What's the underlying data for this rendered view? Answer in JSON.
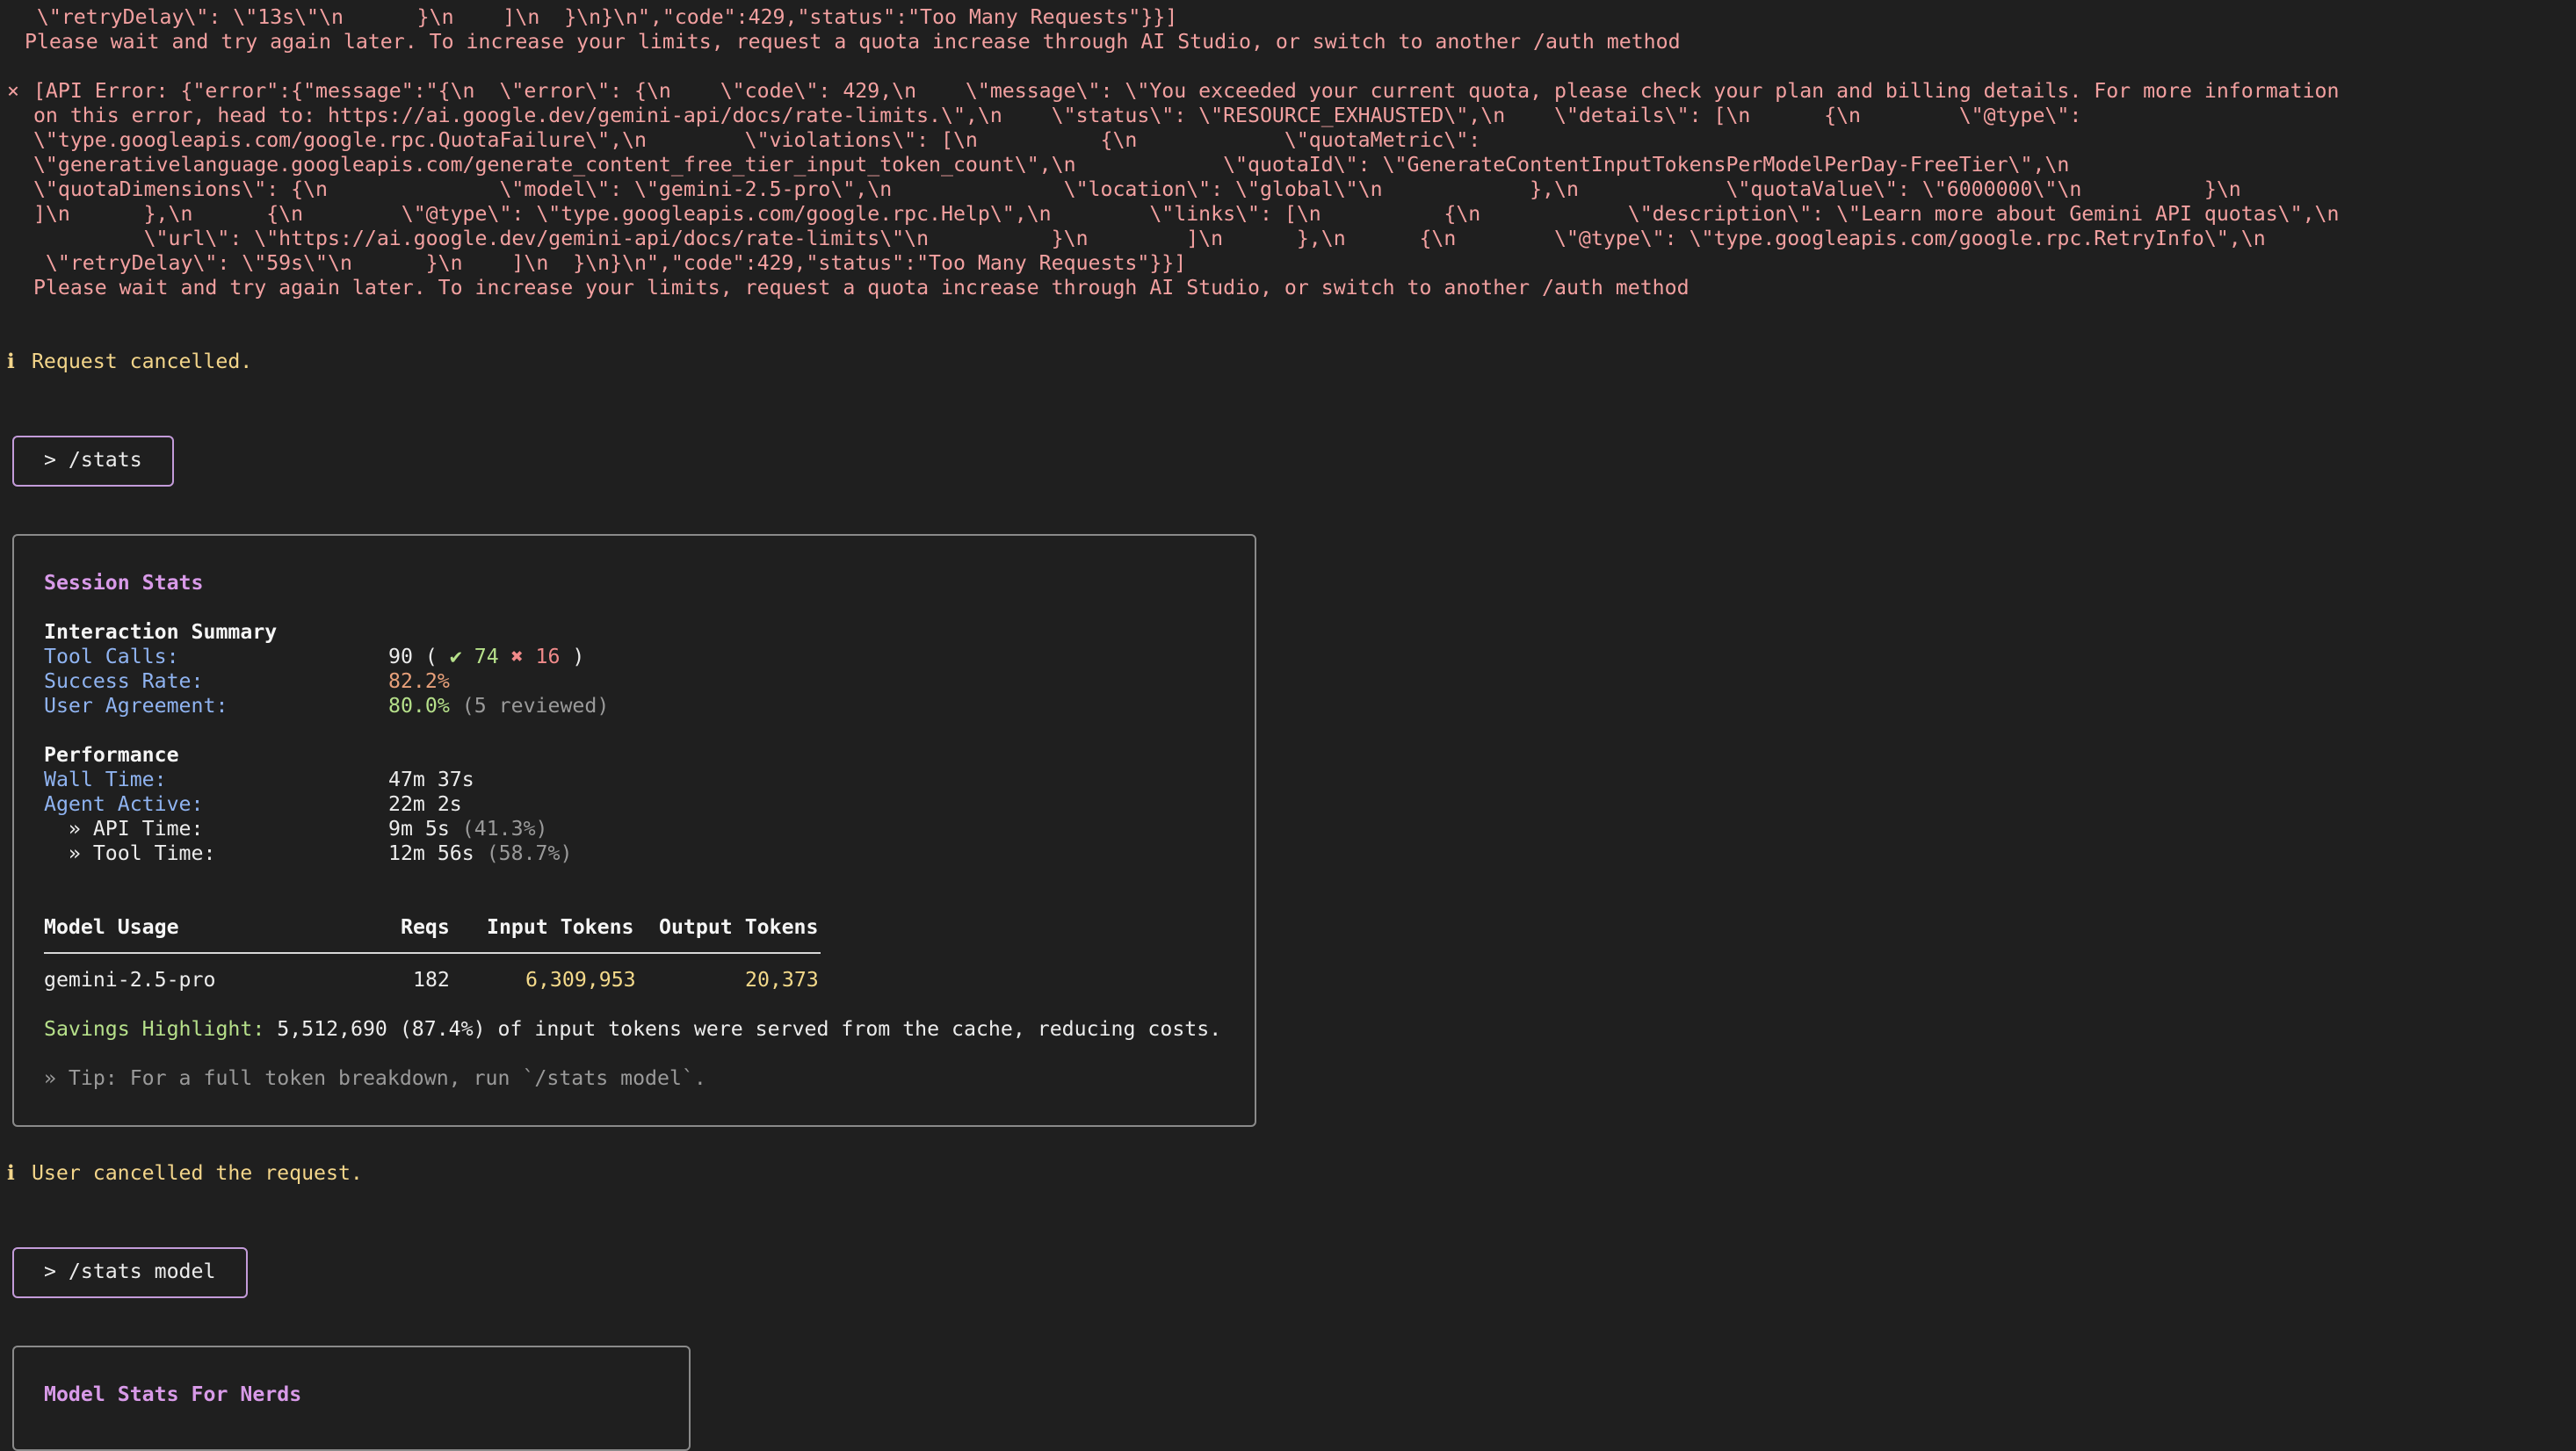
{
  "colors": {
    "background": "#1f1f1f",
    "error": "#f2a0a0",
    "info": "#f3d58a",
    "accent_border": "#c39bd9",
    "panel_title": "#d89ae8",
    "label": "#8fb3f0",
    "success": "#b6e08a",
    "fail": "#f08a8a"
  },
  "top_error": {
    "lines": [
      "  \\\"retryDelay\\\": \\\"13s\\\"\\n      }\\n    ]\\n  }\\n}\\n\",\"code\":429,\"status\":\"Too Many Requests\"}}]",
      " Please wait and try again later. To increase your limits, request a quota increase through AI Studio, or switch to another /auth method"
    ]
  },
  "api_error": {
    "icon": "×",
    "lines": [
      " [API Error: {\"error\":{\"message\":\"{\\n  \\\"error\\\": {\\n    \\\"code\\\": 429,\\n    \\\"message\\\": \\\"You exceeded your current quota, please check your plan and billing details. For more information",
      " on this error, head to: https://ai.google.dev/gemini-api/docs/rate-limits.\\\",\\n    \\\"status\\\": \\\"RESOURCE_EXHAUSTED\\\",\\n    \\\"details\\\": [\\n      {\\n        \\\"@type\\\":",
      " \\\"type.googleapis.com/google.rpc.QuotaFailure\\\",\\n        \\\"violations\\\": [\\n          {\\n            \\\"quotaMetric\\\":",
      " \\\"generativelanguage.googleapis.com/generate_content_free_tier_input_token_count\\\",\\n            \\\"quotaId\\\": \\\"GenerateContentInputTokensPerModelPerDay-FreeTier\\\",\\n",
      " \\\"quotaDimensions\\\": {\\n              \\\"model\\\": \\\"gemini-2.5-pro\\\",\\n              \\\"location\\\": \\\"global\\\"\\n            },\\n            \\\"quotaValue\\\": \\\"6000000\\\"\\n          }\\n",
      " ]\\n      },\\n      {\\n        \\\"@type\\\": \\\"type.googleapis.com/google.rpc.Help\\\",\\n        \\\"links\\\": [\\n          {\\n            \\\"description\\\": \\\"Learn more about Gemini API quotas\\\",\\n",
      "          \\\"url\\\": \\\"https://ai.google.dev/gemini-api/docs/rate-limits\\\"\\n          }\\n        ]\\n      },\\n      {\\n        \\\"@type\\\": \\\"type.googleapis.com/google.rpc.RetryInfo\\\",\\n",
      "  \\\"retryDelay\\\": \\\"59s\\\"\\n      }\\n    ]\\n  }\\n}\\n\",\"code\":429,\"status\":\"Too Many Requests\"}}]",
      " Please wait and try again later. To increase your limits, request a quota increase through AI Studio, or switch to another /auth method"
    ]
  },
  "request_cancelled": {
    "icon": "ℹ",
    "text": " Request cancelled."
  },
  "command1": "> /stats",
  "session_stats": {
    "title": "Session Stats",
    "interaction_heading": "Interaction Summary",
    "tool_calls_label": "Tool Calls:",
    "tool_calls_total": "90",
    "tool_calls_open": " ( ",
    "tool_calls_success": "✔ 74",
    "tool_calls_fail": "✖ 16",
    "tool_calls_close": " )",
    "success_rate_label": "Success Rate:",
    "success_rate_value": "82.2%",
    "user_agreement_label": "User Agreement:",
    "user_agreement_value": "80.0%",
    "user_agreement_note": " (5 reviewed)",
    "performance_heading": "Performance",
    "wall_time_label": "Wall Time:",
    "wall_time_value": "47m 37s",
    "agent_active_label": "Agent Active:",
    "agent_active_value": "22m 2s",
    "api_time_label": "  » API Time:",
    "api_time_value": "9m 5s",
    "api_time_pct": " (41.3%)",
    "tool_time_label": "  » Tool Time:",
    "tool_time_value": "12m 56s",
    "tool_time_pct": " (58.7%)",
    "table_headers": [
      "Model Usage",
      "Reqs",
      "Input Tokens",
      "Output Tokens"
    ],
    "model_row": {
      "model": "gemini-2.5-pro",
      "reqs": "182",
      "input_tokens": "6,309,953",
      "output_tokens": "20,373"
    },
    "savings_label": "Savings Highlight:",
    "savings_text": " 5,512,690 (87.4%) of input tokens were served from the cache, reducing costs.",
    "tip": "» Tip: For a full token breakdown, run `/stats model`."
  },
  "user_cancelled": {
    "icon": "ℹ",
    "text": " User cancelled the request."
  },
  "command2": "> /stats model",
  "model_stats": {
    "title": "Model Stats For Nerds"
  }
}
